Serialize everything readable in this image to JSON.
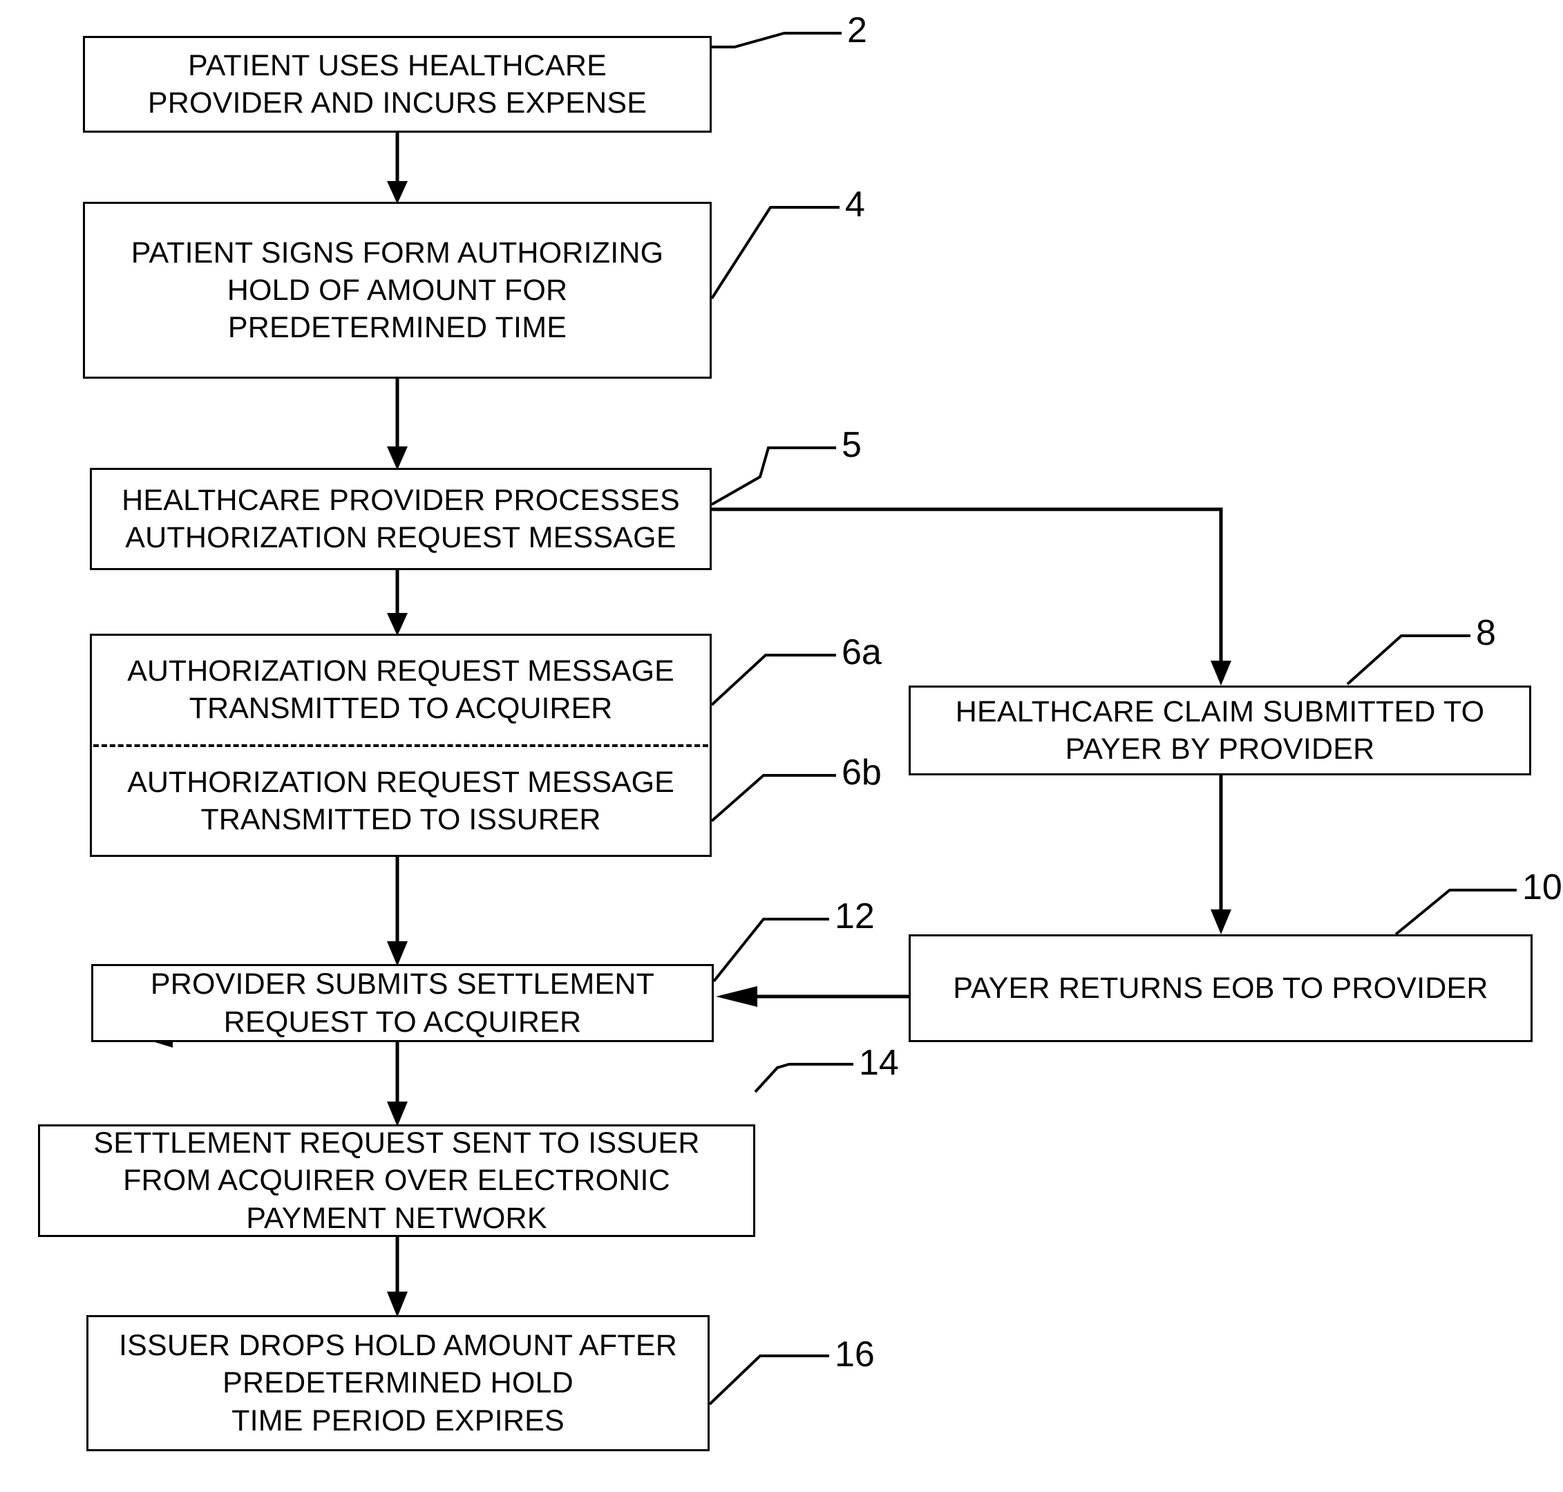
{
  "figure": {
    "type": "flowchart",
    "orientation": "top-to-bottom",
    "background_color": "#ffffff",
    "line_color": "#000000"
  },
  "nodes": {
    "n2": {
      "ref": "2",
      "lines": [
        "PATIENT USES HEALTHCARE",
        "PROVIDER AND INCURS EXPENSE"
      ],
      "text": "PATIENT USES HEALTHCARE PROVIDER AND INCURS EXPENSE"
    },
    "n4": {
      "ref": "4",
      "lines": [
        "PATIENT SIGNS FORM AUTHORIZING",
        "HOLD OF AMOUNT FOR",
        "PREDETERMINED TIME"
      ],
      "text": "PATIENT SIGNS FORM AUTHORIZING HOLD OF AMOUNT FOR PREDETERMINED TIME"
    },
    "n5": {
      "ref": "5",
      "lines": [
        "HEALTHCARE PROVIDER PROCESSES",
        "AUTHORIZATION REQUEST MESSAGE"
      ],
      "text": "HEALTHCARE PROVIDER PROCESSES AUTHORIZATION REQUEST MESSAGE"
    },
    "n6a": {
      "ref": "6a",
      "lines": [
        "AUTHORIZATION REQUEST MESSAGE",
        "TRANSMITTED TO ACQUIRER"
      ],
      "text": "AUTHORIZATION REQUEST MESSAGE TRANSMITTED TO ACQUIRER"
    },
    "n6b": {
      "ref": "6b",
      "lines": [
        "AUTHORIZATION REQUEST MESSAGE",
        "TRANSMITTED TO ISSURER"
      ],
      "text": "AUTHORIZATION REQUEST MESSAGE TRANSMITTED TO ISSURER"
    },
    "n8": {
      "ref": "8",
      "lines": [
        "HEALTHCARE CLAIM SUBMITTED TO",
        "PAYER BY PROVIDER"
      ],
      "text": "HEALTHCARE CLAIM SUBMITTED TO PAYER BY PROVIDER"
    },
    "n10": {
      "ref": "10",
      "lines": [
        "PAYER RETURNS EOB TO PROVIDER"
      ],
      "text": "PAYER RETURNS EOB TO PROVIDER"
    },
    "n12": {
      "ref": "12",
      "lines": [
        "PROVIDER SUBMITS SETTLEMENT",
        "REQUEST TO ACQUIRER"
      ],
      "text": "PROVIDER SUBMITS SETTLEMENT REQUEST TO ACQUIRER"
    },
    "n14": {
      "ref": "14",
      "lines": [
        "SETTLEMENT REQUEST SENT TO ISSUER",
        "FROM ACQUIRER OVER ELECTRONIC",
        "PAYMENT NETWORK"
      ],
      "text": "SETTLEMENT REQUEST SENT TO ISSUER FROM ACQUIRER OVER ELECTRONIC PAYMENT NETWORK"
    },
    "n16": {
      "ref": "16",
      "lines": [
        "ISSUER DROPS HOLD AMOUNT AFTER",
        "PREDETERMINED HOLD",
        "TIME PERIOD EXPIRES"
      ],
      "text": "ISSUER DROPS HOLD AMOUNT AFTER PREDETERMINED HOLD TIME PERIOD EXPIRES"
    }
  },
  "edges": [
    {
      "from": "n2",
      "to": "n4",
      "style": "arrow-down"
    },
    {
      "from": "n4",
      "to": "n5",
      "style": "arrow-down"
    },
    {
      "from": "n5",
      "to": "n6a",
      "style": "arrow-down"
    },
    {
      "from": "n5",
      "to": "n8",
      "style": "elbow-right-then-down-arrow"
    },
    {
      "from": "n6b",
      "to": "n12",
      "style": "arrow-down"
    },
    {
      "from": "n8",
      "to": "n10",
      "style": "arrow-down"
    },
    {
      "from": "n10",
      "to": "n12",
      "style": "arrow-left"
    },
    {
      "from": "n12",
      "to": "n14",
      "style": "arrow-down"
    },
    {
      "from": "n14",
      "to": "n16",
      "style": "arrow-down"
    }
  ]
}
